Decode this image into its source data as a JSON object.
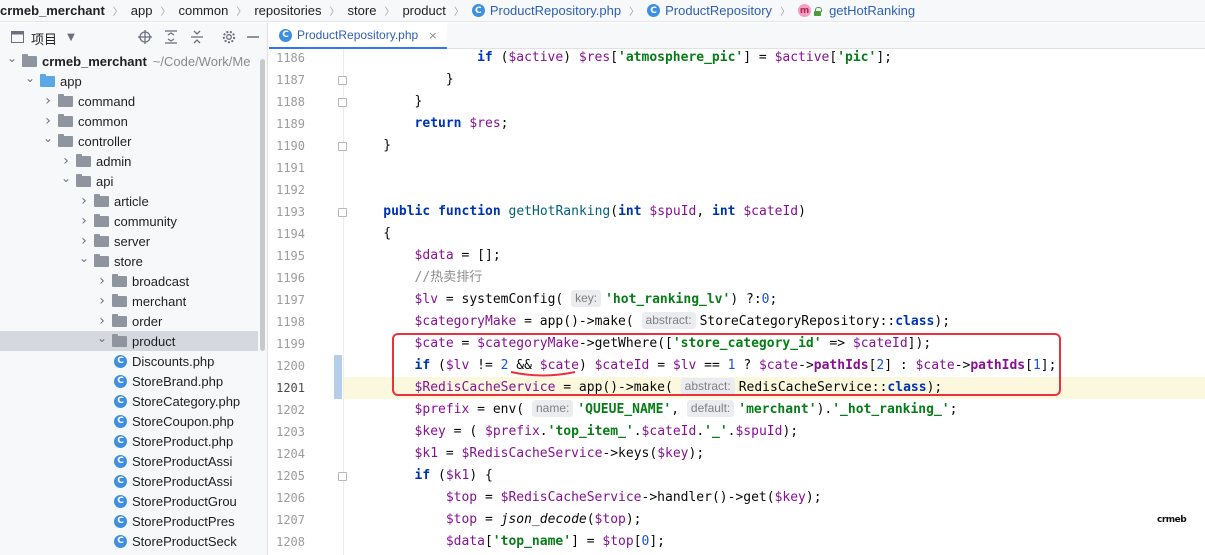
{
  "breadcrumb": [
    {
      "label": "crmeb_merchant",
      "kind": "project"
    },
    {
      "label": "app",
      "kind": "dir"
    },
    {
      "label": "common",
      "kind": "dir"
    },
    {
      "label": "repositories",
      "kind": "dir"
    },
    {
      "label": "store",
      "kind": "dir"
    },
    {
      "label": "product",
      "kind": "dir"
    },
    {
      "label": "ProductRepository.php",
      "kind": "file"
    },
    {
      "label": "ProductRepository",
      "kind": "class"
    },
    {
      "label": "getHotRanking",
      "kind": "method"
    }
  ],
  "project_panel": {
    "title": "项目",
    "toolbar_icons": [
      "locate-icon",
      "expand-all-icon",
      "collapse-all-icon",
      "settings-icon",
      "hide-icon"
    ],
    "tree": [
      {
        "label": "crmeb_merchant",
        "path": "~/Code/Work/Me",
        "depth": 0,
        "type": "folder",
        "expanded": true
      },
      {
        "label": "app",
        "depth": 1,
        "type": "folder-blue",
        "expanded": true
      },
      {
        "label": "command",
        "depth": 2,
        "type": "folder",
        "expanded": false
      },
      {
        "label": "common",
        "depth": 2,
        "type": "folder",
        "expanded": false
      },
      {
        "label": "controller",
        "depth": 2,
        "type": "folder",
        "expanded": true
      },
      {
        "label": "admin",
        "depth": 3,
        "type": "folder",
        "expanded": false
      },
      {
        "label": "api",
        "depth": 3,
        "type": "folder",
        "expanded": true
      },
      {
        "label": "article",
        "depth": 4,
        "type": "folder",
        "expanded": false
      },
      {
        "label": "community",
        "depth": 4,
        "type": "folder",
        "expanded": false
      },
      {
        "label": "server",
        "depth": 4,
        "type": "folder",
        "expanded": false
      },
      {
        "label": "store",
        "depth": 4,
        "type": "folder",
        "expanded": true
      },
      {
        "label": "broadcast",
        "depth": 5,
        "type": "folder",
        "expanded": false
      },
      {
        "label": "merchant",
        "depth": 5,
        "type": "folder",
        "expanded": false
      },
      {
        "label": "order",
        "depth": 5,
        "type": "folder",
        "expanded": false
      },
      {
        "label": "product",
        "depth": 5,
        "type": "folder",
        "expanded": true,
        "selected": true
      },
      {
        "label": "Discounts.php",
        "depth": 6,
        "type": "file"
      },
      {
        "label": "StoreBrand.php",
        "depth": 6,
        "type": "file"
      },
      {
        "label": "StoreCategory.php",
        "depth": 6,
        "type": "file"
      },
      {
        "label": "StoreCoupon.php",
        "depth": 6,
        "type": "file"
      },
      {
        "label": "StoreProduct.php",
        "depth": 6,
        "type": "file"
      },
      {
        "label": "StoreProductAssi",
        "depth": 6,
        "type": "file"
      },
      {
        "label": "StoreProductAssi",
        "depth": 6,
        "type": "file"
      },
      {
        "label": "StoreProductGrou",
        "depth": 6,
        "type": "file"
      },
      {
        "label": "StoreProductPres",
        "depth": 6,
        "type": "file"
      },
      {
        "label": "StoreProductSeck",
        "depth": 6,
        "type": "file"
      }
    ]
  },
  "editor": {
    "tab_label": "ProductRepository.php",
    "tab_close": "×",
    "current_line": 1201,
    "lines": [
      {
        "no": 1186,
        "indent": 16,
        "fold": false,
        "tokens": [
          [
            "kw",
            "if"
          ],
          [
            "p",
            " ("
          ],
          [
            "var",
            "$active"
          ],
          [
            "p",
            ") "
          ],
          [
            "var",
            "$res"
          ],
          [
            "p",
            "["
          ],
          [
            "str",
            "'atmosphere_pic'"
          ],
          [
            "p",
            "] = "
          ],
          [
            "var",
            "$active"
          ],
          [
            "p",
            "["
          ],
          [
            "str",
            "'pic'"
          ],
          [
            "p",
            "];"
          ]
        ]
      },
      {
        "no": 1187,
        "indent": 12,
        "fold": true,
        "tokens": [
          [
            "p",
            "}"
          ]
        ]
      },
      {
        "no": 1188,
        "indent": 8,
        "fold": true,
        "tokens": [
          [
            "p",
            "}"
          ]
        ]
      },
      {
        "no": 1189,
        "indent": 8,
        "fold": false,
        "tokens": [
          [
            "kw",
            "return"
          ],
          [
            "p",
            " "
          ],
          [
            "var",
            "$res"
          ],
          [
            "p",
            ";"
          ]
        ]
      },
      {
        "no": 1190,
        "indent": 4,
        "fold": true,
        "tokens": [
          [
            "p",
            "}"
          ]
        ]
      },
      {
        "no": 1191,
        "indent": 0,
        "fold": false,
        "tokens": []
      },
      {
        "no": 1192,
        "indent": 0,
        "fold": false,
        "tokens": []
      },
      {
        "no": 1193,
        "indent": 4,
        "fold": true,
        "tokens": [
          [
            "kw",
            "public"
          ],
          [
            "p",
            " "
          ],
          [
            "kw",
            "function"
          ],
          [
            "p",
            " "
          ],
          [
            "fn",
            "getHotRanking"
          ],
          [
            "p",
            "("
          ],
          [
            "kw",
            "int"
          ],
          [
            "p",
            " "
          ],
          [
            "var",
            "$spuId"
          ],
          [
            "p",
            ", "
          ],
          [
            "kw",
            "int"
          ],
          [
            "p",
            " "
          ],
          [
            "var",
            "$cateId"
          ],
          [
            "p",
            ")"
          ]
        ]
      },
      {
        "no": 1194,
        "indent": 4,
        "fold": false,
        "tokens": [
          [
            "p",
            "{"
          ]
        ]
      },
      {
        "no": 1195,
        "indent": 8,
        "fold": false,
        "tokens": [
          [
            "var",
            "$data"
          ],
          [
            "p",
            " = [];"
          ]
        ]
      },
      {
        "no": 1196,
        "indent": 8,
        "fold": false,
        "tokens": [
          [
            "cmt",
            "//热卖排行"
          ]
        ]
      },
      {
        "no": 1197,
        "indent": 8,
        "fold": false,
        "tokens": [
          [
            "var",
            "$lv"
          ],
          [
            "p",
            " = systemConfig( "
          ],
          [
            "hint",
            "key:"
          ],
          [
            "str",
            "'hot_ranking_lv'"
          ],
          [
            "p",
            ") ?:"
          ],
          [
            "num",
            "0"
          ],
          [
            "p",
            ";"
          ]
        ]
      },
      {
        "no": 1198,
        "indent": 8,
        "fold": false,
        "tokens": [
          [
            "var",
            "$categoryMake"
          ],
          [
            "p",
            " = app()->make( "
          ],
          [
            "hint",
            "abstract:"
          ],
          [
            "p",
            "StoreCategoryRepository::"
          ],
          [
            "kw",
            "class"
          ],
          [
            "p",
            ");"
          ]
        ]
      },
      {
        "no": 1199,
        "indent": 8,
        "fold": false,
        "tokens": [
          [
            "var",
            "$cate"
          ],
          [
            "p",
            " = "
          ],
          [
            "var",
            "$categoryMake"
          ],
          [
            "p",
            "->getWhere(["
          ],
          [
            "str",
            "'store_category_id'"
          ],
          [
            "p",
            " => "
          ],
          [
            "var",
            "$cateId"
          ],
          [
            "p",
            "]);"
          ]
        ]
      },
      {
        "no": 1200,
        "indent": 8,
        "fold": false,
        "tokens": [
          [
            "kw",
            "if"
          ],
          [
            "p",
            " ("
          ],
          [
            "var",
            "$lv"
          ],
          [
            "p",
            " != "
          ],
          [
            "num",
            "2"
          ],
          [
            "p",
            " && "
          ],
          [
            "var",
            "$cate"
          ],
          [
            "p",
            ") "
          ],
          [
            "var",
            "$cateId"
          ],
          [
            "p",
            " = "
          ],
          [
            "var",
            "$lv"
          ],
          [
            "p",
            " == "
          ],
          [
            "num",
            "1"
          ],
          [
            "p",
            " ? "
          ],
          [
            "var",
            "$cate"
          ],
          [
            "p",
            "->"
          ],
          [
            "prop",
            "pathIds"
          ],
          [
            "p",
            "["
          ],
          [
            "num",
            "2"
          ],
          [
            "p",
            "] : "
          ],
          [
            "var",
            "$cate"
          ],
          [
            "p",
            "->"
          ],
          [
            "prop",
            "pathIds"
          ],
          [
            "p",
            "["
          ],
          [
            "num",
            "1"
          ],
          [
            "p",
            "];"
          ]
        ]
      },
      {
        "no": 1201,
        "indent": 8,
        "fold": false,
        "tokens": [
          [
            "var",
            "$RedisCacheService"
          ],
          [
            "p",
            " = app()->make( "
          ],
          [
            "hint",
            "abstract:"
          ],
          [
            "p",
            "RedisCacheService::"
          ],
          [
            "kw",
            "class"
          ],
          [
            "p",
            ");"
          ]
        ]
      },
      {
        "no": 1202,
        "indent": 8,
        "fold": false,
        "tokens": [
          [
            "var",
            "$prefix"
          ],
          [
            "p",
            " = env( "
          ],
          [
            "hint",
            "name:"
          ],
          [
            "str",
            "'QUEUE_NAME'"
          ],
          [
            "p",
            ", "
          ],
          [
            "hint",
            "default:"
          ],
          [
            "str",
            "'merchant'"
          ],
          [
            "p",
            ")."
          ],
          [
            "str",
            "'_hot_ranking_'"
          ],
          [
            "p",
            ";"
          ]
        ]
      },
      {
        "no": 1203,
        "indent": 8,
        "fold": false,
        "tokens": [
          [
            "var",
            "$key"
          ],
          [
            "p",
            " = ( "
          ],
          [
            "var",
            "$prefix"
          ],
          [
            "p",
            "."
          ],
          [
            "str",
            "'top_item_'"
          ],
          [
            "p",
            "."
          ],
          [
            "var",
            "$cateId"
          ],
          [
            "p",
            "."
          ],
          [
            "str",
            "'_'"
          ],
          [
            "p",
            "."
          ],
          [
            "var",
            "$spuId"
          ],
          [
            "p",
            ");"
          ]
        ]
      },
      {
        "no": 1204,
        "indent": 8,
        "fold": false,
        "tokens": [
          [
            "var",
            "$k1"
          ],
          [
            "p",
            " = "
          ],
          [
            "var",
            "$RedisCacheService"
          ],
          [
            "p",
            "->keys("
          ],
          [
            "var",
            "$key"
          ],
          [
            "p",
            ");"
          ]
        ]
      },
      {
        "no": 1205,
        "indent": 8,
        "fold": true,
        "tokens": [
          [
            "kw",
            "if"
          ],
          [
            "p",
            " ("
          ],
          [
            "var",
            "$k1"
          ],
          [
            "p",
            ") {"
          ]
        ]
      },
      {
        "no": 1206,
        "indent": 12,
        "fold": false,
        "tokens": [
          [
            "var",
            "$top"
          ],
          [
            "p",
            " = "
          ],
          [
            "var",
            "$RedisCacheService"
          ],
          [
            "p",
            "->handler()->get("
          ],
          [
            "var",
            "$key"
          ],
          [
            "p",
            ");"
          ]
        ]
      },
      {
        "no": 1207,
        "indent": 12,
        "fold": false,
        "tokens": [
          [
            "var",
            "$top"
          ],
          [
            "p",
            " = "
          ],
          [
            "fnit",
            "json_decode"
          ],
          [
            "p",
            "("
          ],
          [
            "var",
            "$top"
          ],
          [
            "p",
            ");"
          ]
        ]
      },
      {
        "no": 1208,
        "indent": 12,
        "fold": false,
        "tokens": [
          [
            "var",
            "$data"
          ],
          [
            "p",
            "["
          ],
          [
            "str",
            "'top_name'"
          ],
          [
            "p",
            "] = "
          ],
          [
            "var",
            "$top"
          ],
          [
            "p",
            "["
          ],
          [
            "num",
            "0"
          ],
          [
            "p",
            "];"
          ]
        ]
      }
    ]
  },
  "watermark": "crmeb",
  "colors": {
    "annotation": "#e8323f",
    "keyword": "#0033b3",
    "variable": "#871094",
    "string": "#067d17",
    "number": "#1750eb"
  }
}
